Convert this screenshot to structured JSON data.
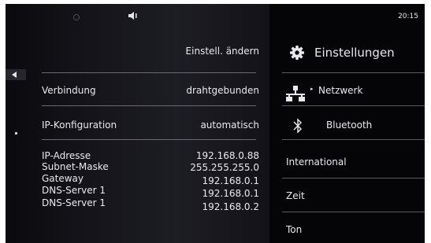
{
  "status": {
    "time": "20:15"
  },
  "page": {
    "header_button": "Einstell. ändern"
  },
  "connection": {
    "label": "Verbindung",
    "value": "drahtgebunden"
  },
  "ip_config": {
    "label": "IP-Konfiguration",
    "value": "automatisch"
  },
  "details": [
    {
      "label": "IP-Adresse",
      "value": "192.168.0.88"
    },
    {
      "label": "Subnet-Maske",
      "value": "255.255.255.0"
    },
    {
      "label": "Gateway",
      "value": "192.168.0.1"
    },
    {
      "label": "DNS-Server 1",
      "value": "192.168.0.1"
    },
    {
      "label": "DNS-Server 1",
      "value": "192.168.0.2"
    }
  ],
  "menu": {
    "title": "Einstellungen",
    "items": [
      {
        "label": "Netzwerk",
        "icon": "network-icon"
      },
      {
        "label": "Bluetooth",
        "icon": "bluetooth-icon"
      },
      {
        "label": "International"
      },
      {
        "label": "Zeit"
      },
      {
        "label": "Ton"
      }
    ]
  },
  "colors": {
    "background": "#0b0b0f",
    "text": "#e9e9ee",
    "divider": "#6a6a72"
  }
}
